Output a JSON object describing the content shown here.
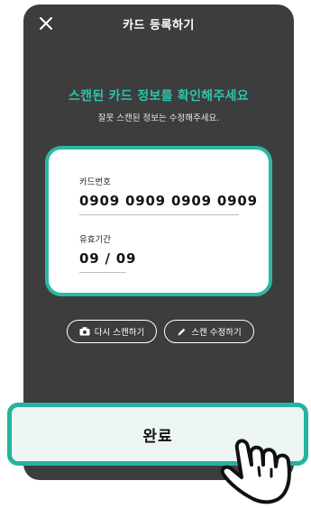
{
  "header": {
    "close_icon": "close-icon",
    "title": "카드 등록하기"
  },
  "intro": {
    "headline": "스캔된 카드 정보를 확인해주세요",
    "subtext": "잘못 스캔된 정보는 수정해주세요."
  },
  "card_form": {
    "card_number_label": "카드번호",
    "card_number_value": "0909  0909  0909  0909",
    "expiry_label": "유효기간",
    "expiry_value": "09 / 09"
  },
  "actions": {
    "rescan_icon": "camera-icon",
    "rescan_label": "다시 스캔하기",
    "edit_icon": "pencil-icon",
    "edit_label": "스캔 수정하기"
  },
  "footer": {
    "done_label": "완료",
    "pointer_icon": "hand-pointer-icon"
  },
  "colors": {
    "accent": "#2cc4ad",
    "screen_background": "#3d3d3d",
    "button_background": "#edf6f4"
  }
}
